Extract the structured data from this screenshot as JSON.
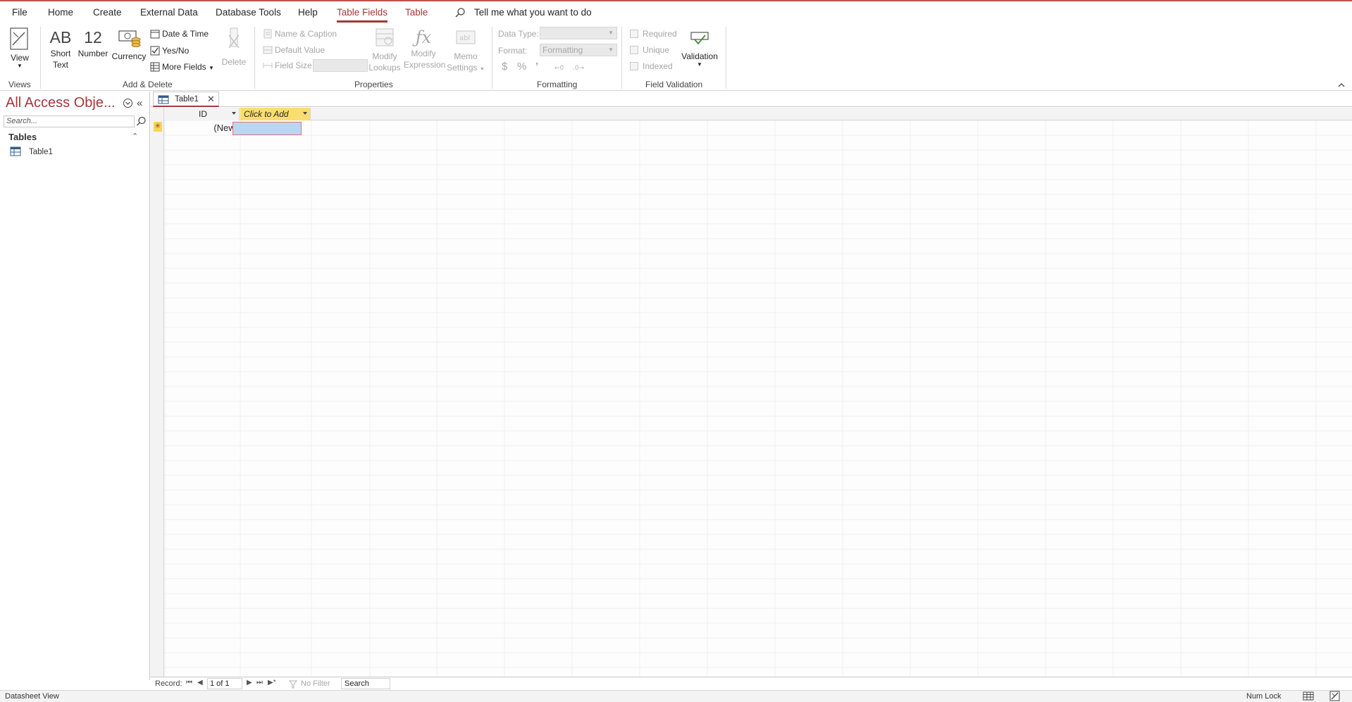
{
  "menubar": {
    "tabs": [
      "File",
      "Home",
      "Create",
      "External Data",
      "Database Tools",
      "Help",
      "Table Fields",
      "Table"
    ],
    "active_tab": "Table Fields",
    "tell_me": "Tell me what you want to do"
  },
  "ribbon": {
    "views": {
      "view_label": "View",
      "group": "Views"
    },
    "add_delete": {
      "short_text_big": "AB",
      "short_text_label1": "Short",
      "short_text_label2": "Text",
      "number_big": "12",
      "number_label": "Number",
      "currency_label": "Currency",
      "date_time": "Date & Time",
      "yes_no": "Yes/No",
      "more_fields": "More Fields",
      "delete": "Delete",
      "group": "Add & Delete"
    },
    "properties": {
      "name_caption": "Name & Caption",
      "default_value": "Default Value",
      "field_size": "Field Size",
      "modify_lookups_1": "Modify",
      "modify_lookups_2": "Lookups",
      "modify_expression_1": "Modify",
      "modify_expression_2": "Expression",
      "memo_settings_1": "Memo",
      "memo_settings_2": "Settings",
      "group": "Properties"
    },
    "formatting": {
      "data_type_label": "Data Type:",
      "format_label": "Format:",
      "format_value": "Formatting",
      "currency_symbol": "$",
      "percent_symbol": "%",
      "comma_symbol": "’",
      "group": "Formatting"
    },
    "field_validation": {
      "required": "Required",
      "unique": "Unique",
      "indexed": "Indexed",
      "validation": "Validation",
      "group": "Field Validation"
    }
  },
  "navpane": {
    "title": "All Access Obje...",
    "search_placeholder": "Search...",
    "section": "Tables",
    "items": [
      {
        "label": "Table1"
      }
    ]
  },
  "document": {
    "tab_label": "Table1",
    "columns": [
      "ID",
      "Click to Add"
    ],
    "new_row_marker": "✳",
    "new_row_value": "(New)"
  },
  "record_nav": {
    "label": "Record:",
    "position": "1 of 1",
    "filter": "No Filter",
    "search": "Search"
  },
  "statusbar": {
    "view": "Datasheet View",
    "num_lock": "Num Lock"
  },
  "colors": {
    "accent": "#a4373a",
    "header_yellow": "#f9dd6f",
    "selection_blue": "#b8d7f2"
  }
}
